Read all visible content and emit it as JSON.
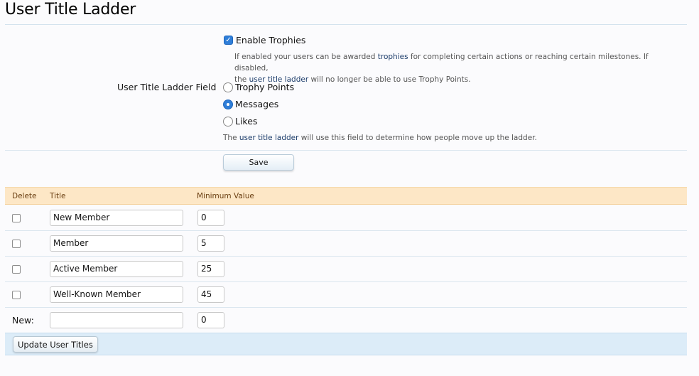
{
  "page": {
    "title": "User Title Ladder"
  },
  "options": {
    "enable_trophies": {
      "label": "Enable Trophies",
      "checked": true,
      "explain_1": "If enabled your users can be awarded ",
      "explain_link_1": "trophies",
      "explain_2": " for completing certain actions or reaching certain milestones. If disabled,",
      "explain_3": "the ",
      "explain_link_2": "user title ladder",
      "explain_4": " will no longer be able to use Trophy Points."
    },
    "ladder_field": {
      "label": "User Title Ladder Field",
      "choices": [
        {
          "label": "Trophy Points",
          "selected": false
        },
        {
          "label": "Messages",
          "selected": true
        },
        {
          "label": "Likes",
          "selected": false
        }
      ],
      "explain_1": "The ",
      "explain_link": "user title ladder",
      "explain_2": " will use this field to determine how people move up the ladder."
    },
    "save_label": "Save"
  },
  "table": {
    "headers": {
      "delete": "Delete",
      "title": "Title",
      "minimum": "Minimum Value"
    },
    "rows": [
      {
        "title": "New Member",
        "minimum": "0"
      },
      {
        "title": "Member",
        "minimum": "5"
      },
      {
        "title": "Active Member",
        "minimum": "25"
      },
      {
        "title": "Well-Known Member",
        "minimum": "45"
      }
    ],
    "new_row": {
      "label": "New:",
      "title": "",
      "minimum": "0"
    }
  },
  "footer": {
    "update_label": "Update User Titles"
  },
  "colors": {
    "accent": "#2f7ed8",
    "link": "#1d3d6b",
    "table_header_bg": "#fde7c6",
    "footer_bg": "#dcecf8"
  }
}
